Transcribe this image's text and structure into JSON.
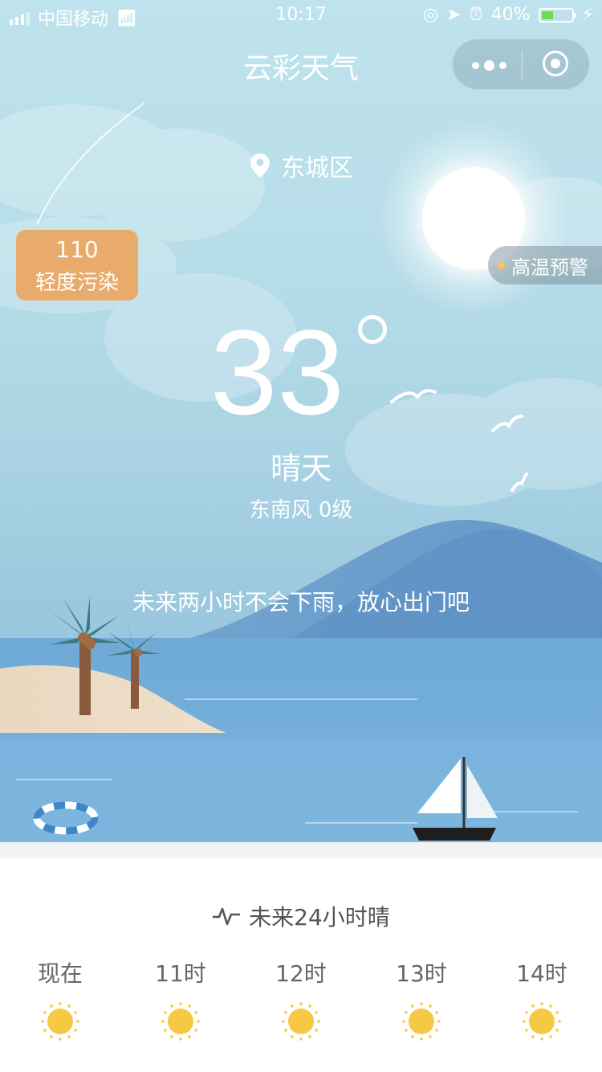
{
  "status_bar": {
    "carrier": "中国移动",
    "time": "10:17",
    "battery": "40%",
    "battery_level": 0.4
  },
  "nav": {
    "title": "云彩天气"
  },
  "location": "东城区",
  "aqi": {
    "value": "110",
    "label": "轻度污染"
  },
  "warning": "高温预警",
  "current": {
    "temperature": "33",
    "condition": "晴天",
    "wind": "东南风 0级",
    "tip": "未来两小时不会下雨，放心出门吧"
  },
  "forecast": {
    "title": "未来24小时晴",
    "hours": [
      {
        "label": "现在",
        "icon": "sun-icon",
        "temp": ""
      },
      {
        "label": "11时",
        "icon": "sun-icon",
        "temp": ""
      },
      {
        "label": "12时",
        "icon": "sun-icon",
        "temp": ""
      },
      {
        "label": "13时",
        "icon": "sun-icon",
        "temp": ""
      },
      {
        "label": "14时",
        "icon": "sun-icon",
        "temp": ""
      }
    ]
  },
  "colors": {
    "aqi_badge": "#e9ab6c",
    "sun": "#f6c944",
    "battery": "#6fdc4f"
  }
}
